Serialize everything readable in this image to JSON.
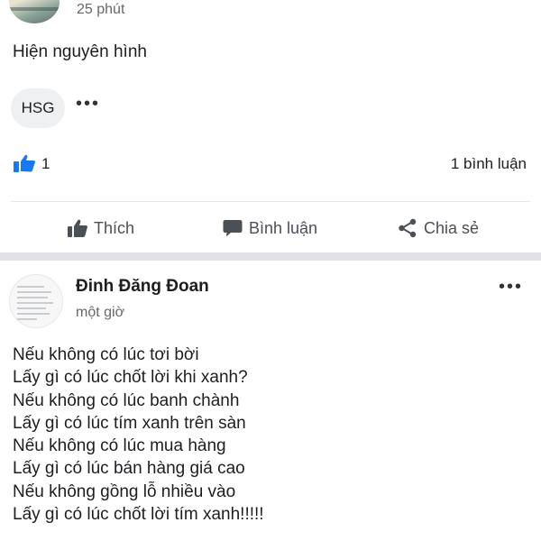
{
  "post1": {
    "time": "25 phút",
    "text": "Hiện nguyên hình",
    "tag": "HSG",
    "more": "•••",
    "like_count": "1",
    "comment_count": "1 bình luận",
    "actions": {
      "like": "Thích",
      "comment": "Bình luận",
      "share": "Chia sẻ"
    }
  },
  "post2": {
    "author": "Đinh Đăng Đoan",
    "time": "một giờ",
    "more": "•••",
    "lines": [
      "Nếu không có lúc tơi bời",
      "Lấy gì có lúc chốt lời khi xanh?",
      "Nếu không có lúc banh chành",
      "Lấy gì có lúc tím xanh trên sàn",
      "Nếu không có lúc mua hàng",
      "Lấy gì có lúc bán hàng giá cao",
      "Nếu không gồng lỗ nhiều vào",
      "Lấy gì có lúc chốt lời tím xanh!!!!!"
    ]
  },
  "colors": {
    "like_blue": "#1877f2",
    "text": "#1c1e21",
    "muted": "#65676b",
    "action": "#4b4f56"
  },
  "icons": [
    "thumbs-up-icon",
    "speech-bubble-icon",
    "share-icon",
    "more-dots-icon"
  ]
}
